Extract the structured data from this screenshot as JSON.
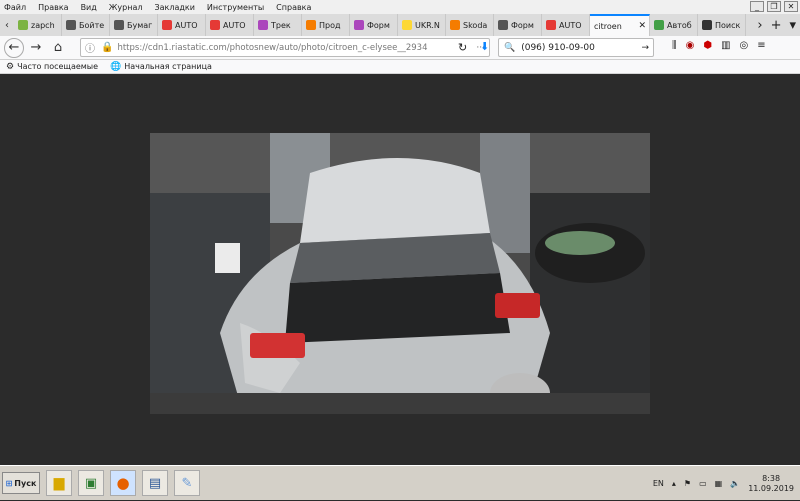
{
  "menu": {
    "items": [
      "Файл",
      "Правка",
      "Вид",
      "Журнал",
      "Закладки",
      "Инструменты",
      "Справка"
    ]
  },
  "window_controls": {
    "minimize": "_",
    "restore": "❐",
    "close": "✕"
  },
  "tabs": [
    {
      "label": "zapch",
      "color": "#7cb342"
    },
    {
      "label": "Бойте",
      "color": "#555555"
    },
    {
      "label": "Бумаг",
      "color": "#555555"
    },
    {
      "label": "AUTO",
      "color": "#e53935"
    },
    {
      "label": "AUTO",
      "color": "#e53935"
    },
    {
      "label": "Трек",
      "color": "#ab47bc"
    },
    {
      "label": "Прод",
      "color": "#f57c00"
    },
    {
      "label": "Форм",
      "color": "#ab47bc"
    },
    {
      "label": "UKR.N",
      "color": "#fdd835"
    },
    {
      "label": "Skoda",
      "color": "#f57c00"
    },
    {
      "label": "Форм",
      "color": "#555555"
    },
    {
      "label": "AUTO",
      "color": "#e53935"
    },
    {
      "label": "citroen",
      "color": "#1e88e5",
      "active": true
    },
    {
      "label": "Автоб",
      "color": "#43a047"
    },
    {
      "label": "Поиск",
      "color": "#333333"
    }
  ],
  "tab_controls": {
    "scroll_left": "‹",
    "scroll_right": "›",
    "new_tab": "+",
    "list_all": "▾",
    "close": "✕"
  },
  "nav": {
    "url": "https://cdn1.riastatic.com/photosnew/auto/photo/citroen_c-elysee__2934",
    "search_value": "(096) 910-09-00"
  },
  "bookmarks": [
    {
      "label": "Часто посещаемые",
      "icon": "⚙"
    },
    {
      "label": "Начальная страница",
      "icon": "🌐"
    }
  ],
  "taskbar": {
    "start_label": "Пуск",
    "lang": "EN",
    "time": "8:38",
    "date": "11.09.2019"
  },
  "colors": {
    "accent": "#0a84ff",
    "page_bg": "#2b2b2b"
  }
}
